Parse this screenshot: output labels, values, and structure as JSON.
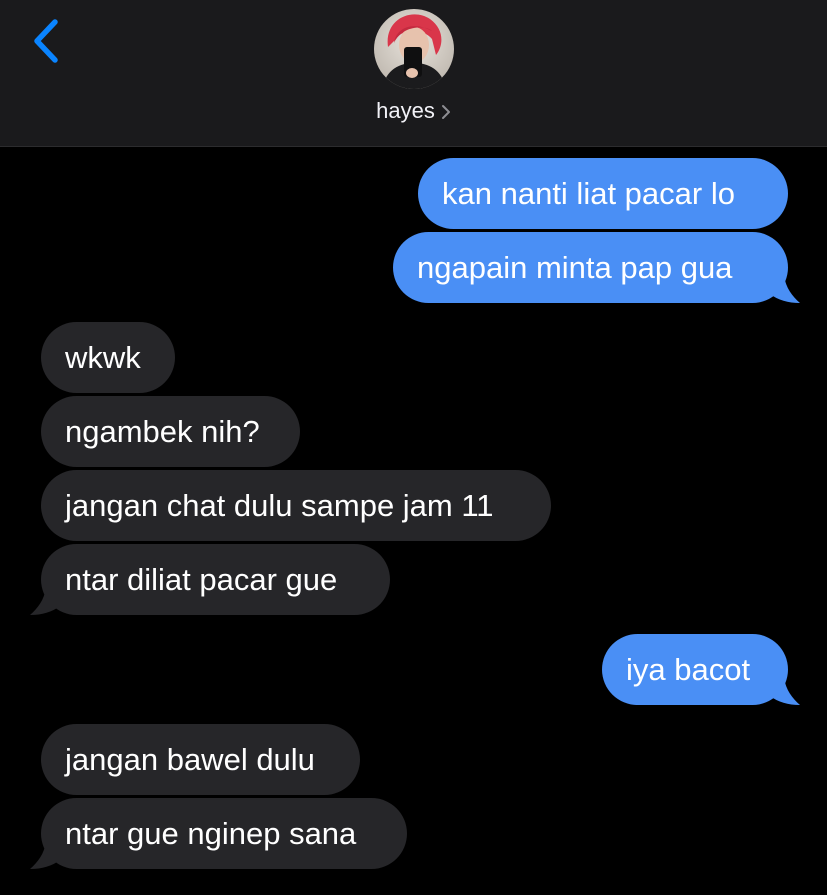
{
  "header": {
    "contact_name": "hayes",
    "icons": {
      "back": "chevron-left-icon",
      "disclosure": "chevron-right-icon"
    },
    "accent_color": "#0a84ff"
  },
  "colors": {
    "sent_bubble": "#4a8ff5",
    "received_bubble": "#262629",
    "background": "#000000"
  },
  "messages": [
    {
      "direction": "sent",
      "text": "kan nanti liat pacar lo"
    },
    {
      "direction": "sent",
      "text": "ngapain minta pap gua"
    },
    {
      "direction": "received",
      "text": "wkwk"
    },
    {
      "direction": "received",
      "text": "ngambek nih?"
    },
    {
      "direction": "received",
      "text": "jangan chat dulu sampe jam 11"
    },
    {
      "direction": "received",
      "text": "ntar diliat pacar gue"
    },
    {
      "direction": "sent",
      "text": "iya bacot"
    },
    {
      "direction": "received",
      "text": "jangan bawel dulu"
    },
    {
      "direction": "received",
      "text": "ntar gue nginep sana"
    }
  ]
}
